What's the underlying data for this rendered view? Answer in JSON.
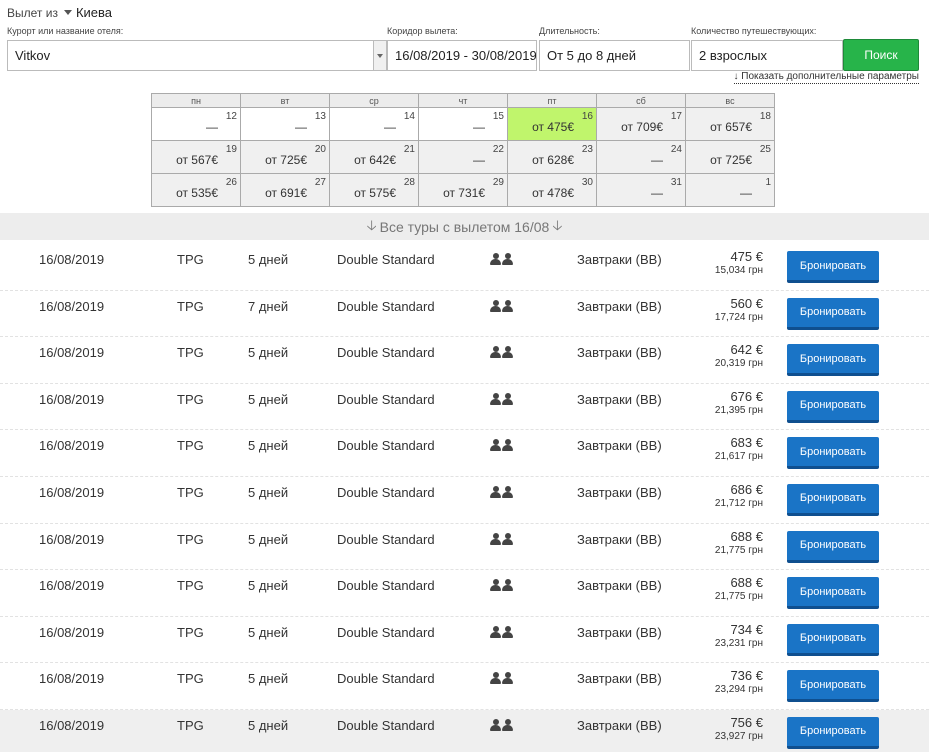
{
  "depart": {
    "label": "Вылет из",
    "city": "Киева"
  },
  "search": {
    "hotel_label": "Курорт или название отеля:",
    "hotel_value": "Vitkov",
    "dates_label": "Коридор вылета:",
    "dates_value": "16/08/2019 - 30/08/2019",
    "duration_label": "Длительность:",
    "duration_value": "От 5 до 8 дней",
    "travelers_label": "Количество путешествующих:",
    "travelers_value": "2 взрослых",
    "search_button": "Поиск",
    "more_params": "↓ Показать дополнительные параметры"
  },
  "calendar": {
    "weekdays": [
      "пн",
      "вт",
      "ср",
      "чт",
      "пт",
      "сб",
      "вс"
    ],
    "weeks": [
      [
        {
          "day": "12",
          "price": "—",
          "tone": "w"
        },
        {
          "day": "13",
          "price": "—",
          "tone": "w"
        },
        {
          "day": "14",
          "price": "—",
          "tone": "w"
        },
        {
          "day": "15",
          "price": "—",
          "tone": "w"
        },
        {
          "day": "16",
          "price": "от 475€",
          "tone": "hl"
        },
        {
          "day": "17",
          "price": "от 709€",
          "tone": "g"
        },
        {
          "day": "18",
          "price": "от 657€",
          "tone": "g"
        }
      ],
      [
        {
          "day": "19",
          "price": "от 567€",
          "tone": "g"
        },
        {
          "day": "20",
          "price": "от 725€",
          "tone": "g"
        },
        {
          "day": "21",
          "price": "от 642€",
          "tone": "g"
        },
        {
          "day": "22",
          "price": "—",
          "tone": "g"
        },
        {
          "day": "23",
          "price": "от 628€",
          "tone": "g"
        },
        {
          "day": "24",
          "price": "—",
          "tone": "g"
        },
        {
          "day": "25",
          "price": "от 725€",
          "tone": "g"
        }
      ],
      [
        {
          "day": "26",
          "price": "от 535€",
          "tone": "g"
        },
        {
          "day": "27",
          "price": "от 691€",
          "tone": "g"
        },
        {
          "day": "28",
          "price": "от 575€",
          "tone": "g"
        },
        {
          "day": "29",
          "price": "от 731€",
          "tone": "g"
        },
        {
          "day": "30",
          "price": "от 478€",
          "tone": "g"
        },
        {
          "day": "31",
          "price": "—",
          "tone": "g"
        },
        {
          "day": "1",
          "price": "—",
          "tone": "g"
        }
      ]
    ]
  },
  "tours_header": "Все туры с вылетом 16/08",
  "tours": [
    {
      "date": "16/08/2019",
      "operator": "TPG",
      "duration": "5 дней",
      "room": "Double Standard",
      "meal": "Завтраки (BB)",
      "price_eur": "475 €",
      "price_uah": "15,034 грн"
    },
    {
      "date": "16/08/2019",
      "operator": "TPG",
      "duration": "7 дней",
      "room": "Double Standard",
      "meal": "Завтраки (BB)",
      "price_eur": "560 €",
      "price_uah": "17,724 грн"
    },
    {
      "date": "16/08/2019",
      "operator": "TPG",
      "duration": "5 дней",
      "room": "Double Standard",
      "meal": "Завтраки (BB)",
      "price_eur": "642 €",
      "price_uah": "20,319 грн"
    },
    {
      "date": "16/08/2019",
      "operator": "TPG",
      "duration": "5 дней",
      "room": "Double Standard",
      "meal": "Завтраки (BB)",
      "price_eur": "676 €",
      "price_uah": "21,395 грн"
    },
    {
      "date": "16/08/2019",
      "operator": "TPG",
      "duration": "5 дней",
      "room": "Double Standard",
      "meal": "Завтраки (BB)",
      "price_eur": "683 €",
      "price_uah": "21,617 грн"
    },
    {
      "date": "16/08/2019",
      "operator": "TPG",
      "duration": "5 дней",
      "room": "Double Standard",
      "meal": "Завтраки (BB)",
      "price_eur": "686 €",
      "price_uah": "21,712 грн"
    },
    {
      "date": "16/08/2019",
      "operator": "TPG",
      "duration": "5 дней",
      "room": "Double Standard",
      "meal": "Завтраки (BB)",
      "price_eur": "688 €",
      "price_uah": "21,775 грн"
    },
    {
      "date": "16/08/2019",
      "operator": "TPG",
      "duration": "5 дней",
      "room": "Double Standard",
      "meal": "Завтраки (BB)",
      "price_eur": "688 €",
      "price_uah": "21,775 грн"
    },
    {
      "date": "16/08/2019",
      "operator": "TPG",
      "duration": "5 дней",
      "room": "Double Standard",
      "meal": "Завтраки (BB)",
      "price_eur": "734 €",
      "price_uah": "23,231 грн"
    },
    {
      "date": "16/08/2019",
      "operator": "TPG",
      "duration": "5 дней",
      "room": "Double Standard",
      "meal": "Завтраки (BB)",
      "price_eur": "736 €",
      "price_uah": "23,294 грн"
    },
    {
      "date": "16/08/2019",
      "operator": "TPG",
      "duration": "5 дней",
      "room": "Double Standard",
      "meal": "Завтраки (BB)",
      "price_eur": "756 €",
      "price_uah": "23,927 грн"
    }
  ],
  "book_label": "Бронировать",
  "icons": {
    "travelers": "two-persons-icon",
    "departure_dropdown": "caret-down-icon",
    "hotel_dropdown": "caret-down-icon",
    "tours_arrow": "arrow-down-icon"
  },
  "colors": {
    "search_button": "#27b44a",
    "book_button": "#1a74c6",
    "calendar_highlight": "#c0f56c"
  }
}
